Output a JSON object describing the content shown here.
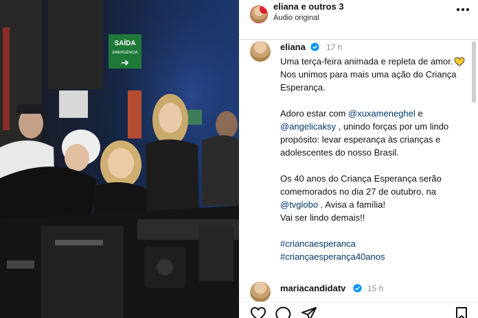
{
  "header": {
    "title": "eliana e outros 3",
    "subtitle": "Áudio original",
    "avatar_icon": "profile-avatar-icon",
    "more_icon": "more-options-icon"
  },
  "photo": {
    "sign_title": "SAÍDA",
    "sign_sub": "EMERGÊNCIA",
    "sign_arrow": "➜"
  },
  "caption": {
    "username": "eliana",
    "time": "17 h",
    "line1": "Uma terça-feira animada e repleta de amor.",
    "line2": "Nos unimos para mais uma ação do Criança Esperança.",
    "p2_start": "Adoro estar com ",
    "mention1": "@xuxameneghel",
    "p2_mid": " e ",
    "mention2": "@angelicaksy",
    "p2_end": " , unindo forças por um lindo propósito: levar esperança às crianças e adolescentes do nosso Brasil.",
    "p3_start": "Os 40 anos do Criança Esperança serão comemorados no dia 27 de outubro, na ",
    "mention3": "@tvglobo",
    "p3_end": " . Avisa a família!",
    "p3_line2": "Vai ser lindo demais!!",
    "hashtag1": "#criancaesperanca",
    "hashtag2": "#criançaesperança40anos",
    "emoji": "yellow-heart"
  },
  "comment": {
    "username": "mariacandidatv",
    "time": "15 h"
  },
  "actions": [
    "like-heart-icon",
    "comment-icon",
    "share-icon",
    "save-bookmark-icon"
  ],
  "colors": {
    "link": "#00376b",
    "muted": "#8e8e8e",
    "verified": "#0095f6",
    "emoji": "#ffcc33",
    "exit_sign": "#1f7a3a"
  }
}
